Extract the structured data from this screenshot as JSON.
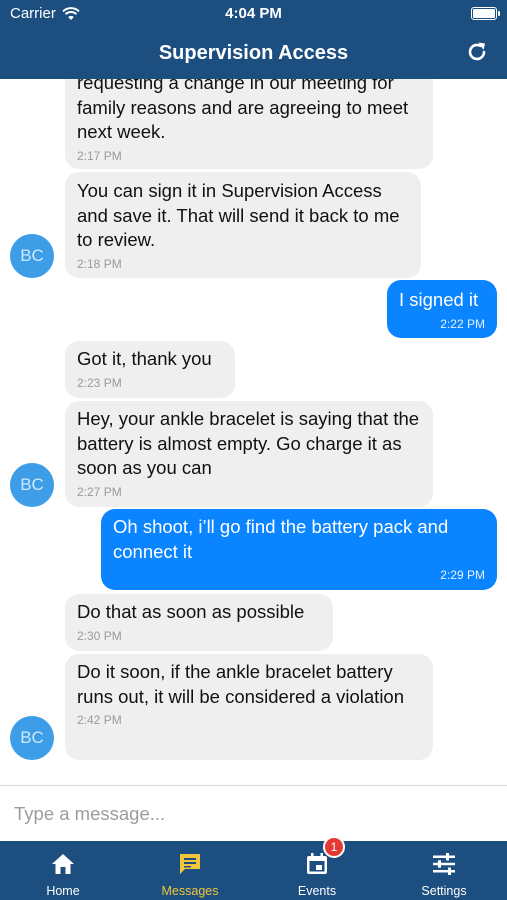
{
  "status_bar": {
    "carrier": "Carrier",
    "time": "4:04 PM"
  },
  "header": {
    "title": "Supervision Access"
  },
  "messages": [
    {
      "dir": "in",
      "text": "requesting a change in our meeting for family reasons and are agreeing to meet next week.",
      "time": "2:17 PM"
    },
    {
      "dir": "in",
      "text": "You can sign it in Supervision Access and save it. That will send it back to me to review.",
      "time": "2:18 PM",
      "avatar": "BC"
    },
    {
      "dir": "out",
      "text": "I signed it",
      "time": "2:22 PM"
    },
    {
      "dir": "in",
      "text": "Got it, thank you",
      "time": "2:23 PM"
    },
    {
      "dir": "in",
      "text": "Hey, your ankle bracelet is saying that the battery is almost empty. Go charge it as soon as you can",
      "time": "2:27 PM",
      "avatar": "BC"
    },
    {
      "dir": "out",
      "text": "Oh shoot, i’ll go find the battery pack and connect it",
      "time": "2:29 PM"
    },
    {
      "dir": "in",
      "text": "Do that as soon as possible",
      "time": "2:30 PM"
    },
    {
      "dir": "in",
      "text": "Do it soon, if the ankle bracelet battery runs out, it will be considered a violation",
      "time": "2:42 PM",
      "avatar": "BC"
    }
  ],
  "composer": {
    "placeholder": "Type a message..."
  },
  "tabs": [
    {
      "label": "Home",
      "icon": "home-icon"
    },
    {
      "label": "Messages",
      "icon": "message-icon",
      "active": true
    },
    {
      "label": "Events",
      "icon": "calendar-icon",
      "badge": "1"
    },
    {
      "label": "Settings",
      "icon": "sliders-icon"
    }
  ],
  "colors": {
    "header": "#1c4e80",
    "outgoing": "#0a84ff",
    "incoming": "#efefef",
    "avatar": "#3d9de6",
    "active_tab": "#f2c53d",
    "badge": "#e53935"
  }
}
